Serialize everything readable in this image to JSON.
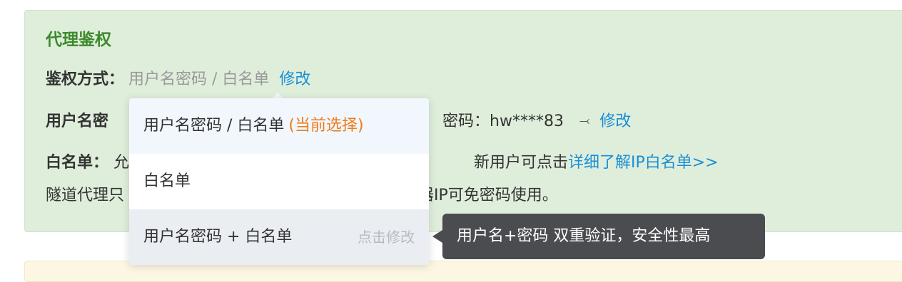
{
  "panel": {
    "title": "代理鉴权",
    "auth_method": {
      "label": "鉴权方式：",
      "value": "用户名密码 / 白名单",
      "edit": "修改"
    },
    "userpass": {
      "label_visible": "用户名密",
      "password_label": "密码：",
      "password_value": "hw****83",
      "eye_icon_glyph": "⤙",
      "edit": "修改"
    },
    "whitelist": {
      "label": "白名单：",
      "clipped": "允"
    },
    "new_user": {
      "text": "新用户可点击",
      "link": "详细了解IP白名单>>"
    },
    "tunnel": {
      "left": "隧道代理只",
      "right": "器IP可免密码使用。"
    }
  },
  "dropdown": {
    "options": [
      {
        "label": "用户名密码 / 白名单",
        "tag": "(当前选择)"
      },
      {
        "label": "白名单"
      },
      {
        "label": "用户名密码 + 白名单",
        "hint": "点击修改"
      }
    ]
  },
  "tooltip": {
    "text": "用户名+密码 双重验证，安全性最高"
  },
  "colors": {
    "panel_bg": "#dfeedb",
    "title": "#3d8a2e",
    "link": "#1a8fd6",
    "current_tag": "#f07a1a",
    "tooltip_bg": "#4a4c50"
  }
}
